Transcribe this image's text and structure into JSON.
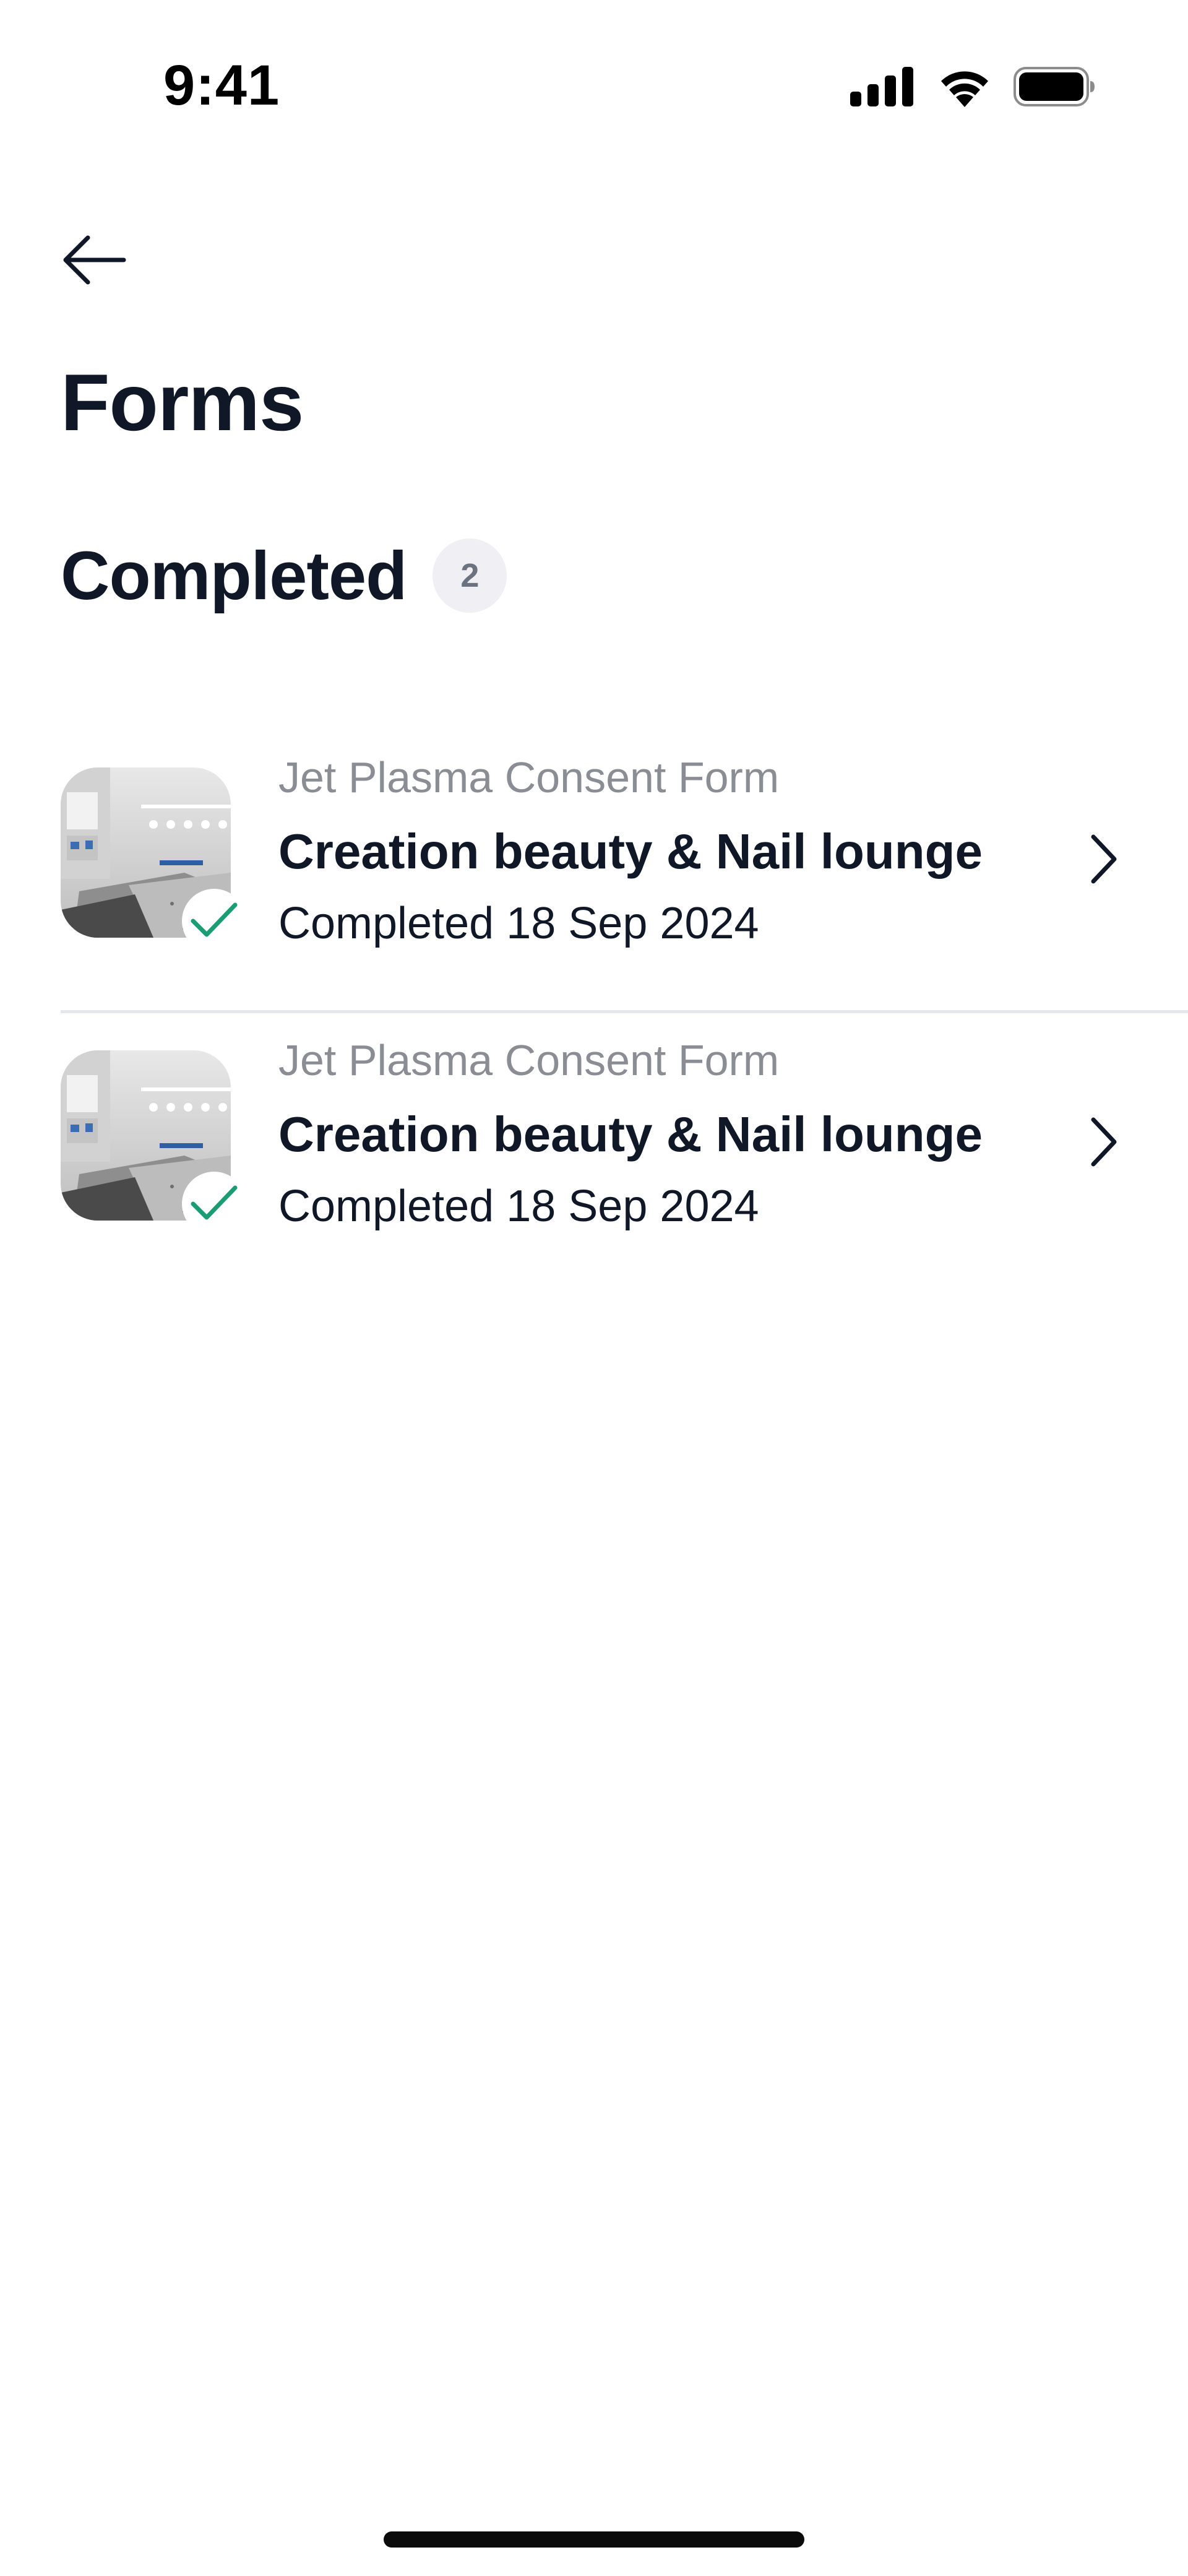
{
  "status_bar": {
    "time": "9:41",
    "icons": [
      "cellular-signal-icon",
      "wifi-icon",
      "battery-icon"
    ]
  },
  "header": {
    "back_icon": "arrow-left-icon",
    "title": "Forms"
  },
  "section": {
    "title": "Completed",
    "count": "2"
  },
  "forms": [
    {
      "form_name": "Jet Plasma Consent Form",
      "business": "Creation beauty & Nail lounge",
      "status": "Completed 18 Sep 2024",
      "thumbnail": "treatment-room-photo",
      "status_icon": "checkmark-icon",
      "nav_icon": "chevron-right-icon"
    },
    {
      "form_name": "Jet Plasma Consent Form",
      "business": "Creation beauty & Nail lounge",
      "status": "Completed 18 Sep 2024",
      "thumbnail": "treatment-room-photo",
      "status_icon": "checkmark-icon",
      "nav_icon": "chevron-right-icon"
    }
  ],
  "colors": {
    "text_primary": "#101828",
    "text_secondary": "#8a8d93",
    "badge_bg": "#efeff4",
    "check_green": "#1a9d73",
    "divider": "#e6e7ea"
  }
}
